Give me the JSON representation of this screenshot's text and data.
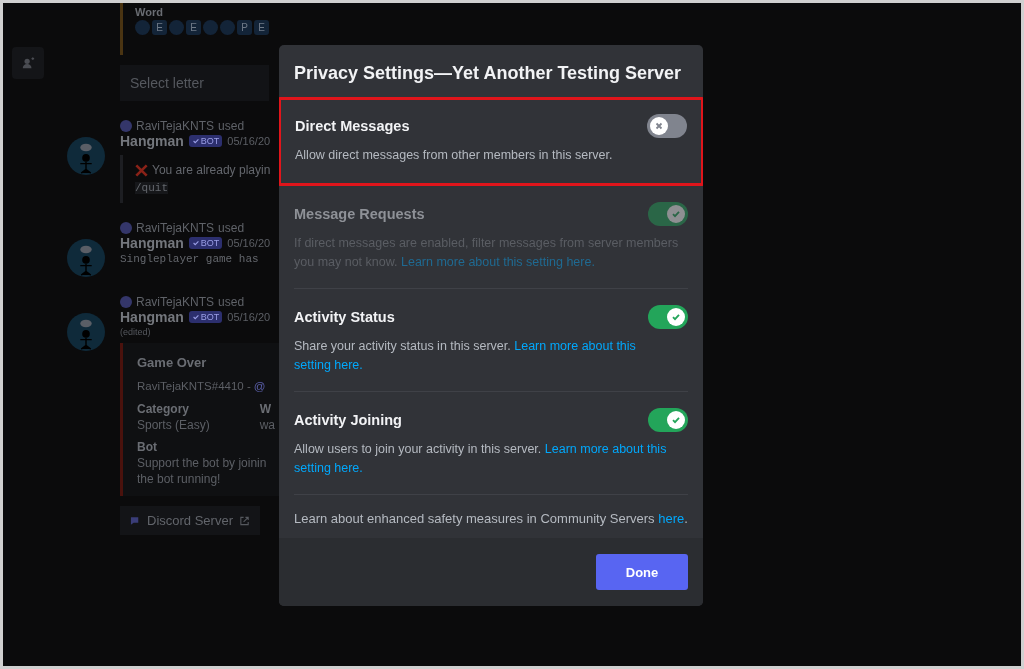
{
  "game_panel": {
    "word_label": "Word",
    "tiles": [
      {
        "revealed": false
      },
      {
        "revealed": true,
        "letter": "E"
      },
      {
        "revealed": false
      },
      {
        "revealed": true,
        "letter": "E"
      },
      {
        "revealed": false
      },
      {
        "revealed": false
      },
      {
        "revealed": true,
        "letter": "P"
      },
      {
        "revealed": true,
        "letter": "E"
      }
    ],
    "select": {
      "placeholder": "Select letter"
    }
  },
  "messages": [
    {
      "kind": "error",
      "user": "RaviTejaKNTS",
      "action": "used",
      "author": "Hangman",
      "badge": "BOT",
      "time": "05/16/20",
      "text": "You are already playin",
      "code": "/quit"
    },
    {
      "kind": "text",
      "user": "RaviTejaKNTS",
      "action": "used",
      "author": "Hangman",
      "badge": "BOT",
      "time": "05/16/20",
      "text": "Singleplayer game has"
    },
    {
      "kind": "game",
      "user": "RaviTejaKNTS",
      "action": "used",
      "author": "Hangman",
      "badge": "BOT",
      "time": "05/16/20",
      "edited": "(edited)",
      "embed": {
        "title": "Game Over",
        "subtitle": "RaviTejaKNTS#4410 -",
        "mention": "@",
        "fields": [
          {
            "name": "Category",
            "value": "Sports (Easy)"
          },
          {
            "name": "W",
            "value": "wa"
          }
        ],
        "section": "Bot",
        "lines": [
          "Support the bot by joinin",
          "the bot running!"
        ]
      },
      "button": "Discord Server"
    }
  ],
  "dialog": {
    "title": "Privacy Settings—Yet Another Testing Server",
    "settings": [
      {
        "label": "Direct Messages",
        "description": "Allow direct messages from other members in this server.",
        "on": false,
        "disabled": false,
        "highlighted": true
      },
      {
        "label": "Message Requests",
        "description": "If direct messages are enabled, filter messages from server members you may not know. ",
        "links": [
          "Learn more about this setting here."
        ],
        "on": true,
        "disabled": true,
        "highlighted": false
      },
      {
        "label": "Activity Status",
        "description": "Share your activity status in this server. ",
        "links": [
          "Learn more about this",
          "setting here."
        ],
        "on": true,
        "disabled": false,
        "highlighted": false
      },
      {
        "label": "Activity Joining",
        "description": "Allow users to join your activity in this server. ",
        "links": [
          "Learn more about this",
          "setting here."
        ],
        "on": true,
        "disabled": false,
        "highlighted": false
      }
    ],
    "note": {
      "text": "Learn about enhanced safety measures in Community Servers ",
      "link": "here",
      "suffix": "."
    },
    "done": "Done"
  }
}
